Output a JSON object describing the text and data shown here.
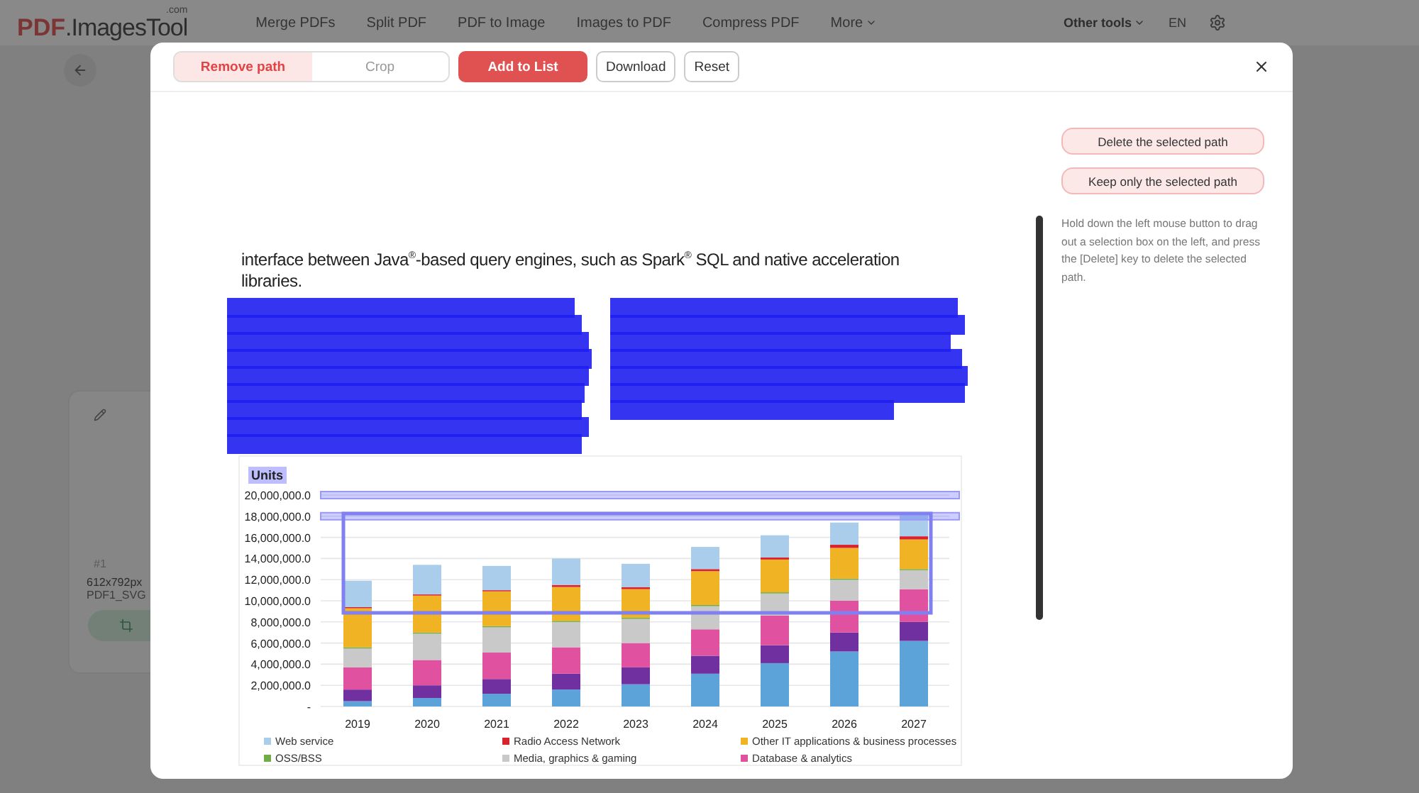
{
  "header": {
    "logo": {
      "brand": "PDF",
      "name": ".ImagesTool",
      "suffix": ".com"
    },
    "nav": [
      "Merge PDFs",
      "Split PDF",
      "PDF to Image",
      "Images to PDF",
      "Compress PDF"
    ],
    "more": "More",
    "other_tools": "Other tools",
    "language": "EN"
  },
  "file_card": {
    "index": "#1",
    "dimensions": "612x792px",
    "filename": "PDF1_SVG"
  },
  "dialog": {
    "modes": [
      {
        "label": "Remove path",
        "selected": true
      },
      {
        "label": "Crop",
        "selected": false
      }
    ],
    "buttons": [
      {
        "label": "Add to List",
        "kind": "primary"
      },
      {
        "label": "Download",
        "kind": "outline"
      },
      {
        "label": "Reset",
        "kind": "outline"
      }
    ],
    "document": {
      "paragraph": "interface between Java$^{®}$-based query engines, such as Spark$^{®}$ SQL and native acceleration libraries.",
      "chart": {
        "units": "Units",
        "chart_data": {
          "type": "bar",
          "stacked": true,
          "orientation": "vertical",
          "grid": true,
          "categories": [
            "2019",
            "2020",
            "2021",
            "2022",
            "2023",
            "2024",
            "2025",
            "2026",
            "2027"
          ],
          "ylim": [
            0,
            20000000
          ],
          "yticks": [
            {
              "value": 0,
              "label": "-"
            },
            {
              "value": 2000000,
              "label": "2,000,000.0"
            },
            {
              "value": 4000000,
              "label": "4,000,000.0"
            },
            {
              "value": 6000000,
              "label": "6,000,000.0"
            },
            {
              "value": 8000000,
              "label": "8,000,000.0"
            },
            {
              "value": 10000000,
              "label": "10,000,000.0"
            },
            {
              "value": 12000000,
              "label": "12,000,000.0"
            },
            {
              "value": 14000000,
              "label": "14,000,000.0"
            },
            {
              "value": 16000000,
              "label": "16,000,000.0"
            },
            {
              "value": 18000000,
              "label": "18,000,000.0"
            },
            {
              "value": 20000000,
              "label": "20,000,000.0"
            }
          ],
          "series": [
            {
              "color": "#5ba3d9",
              "values": [
                500000,
                800000,
                1200000,
                1600000,
                2100000,
                3100000,
                4100000,
                5200000,
                6200000
              ]
            },
            {
              "color": "#7030a0",
              "values": [
                1100000,
                1200000,
                1400000,
                1500000,
                1600000,
                1700000,
                1700000,
                1800000,
                1800000
              ]
            },
            {
              "name": "Database & analytics",
              "color": "#e052a0",
              "values": [
                2100000,
                2400000,
                2500000,
                2500000,
                2300000,
                2500000,
                2800000,
                3000000,
                3100000
              ]
            },
            {
              "name": "Media, graphics & gaming",
              "color": "#c9c9c9",
              "values": [
                1800000,
                2500000,
                2400000,
                2400000,
                2300000,
                2200000,
                2100000,
                2000000,
                1800000
              ]
            },
            {
              "name": "OSS/BSS",
              "color": "#70ad47",
              "values": [
                100000,
                100000,
                100000,
                100000,
                100000,
                100000,
                100000,
                100000,
                100000
              ]
            },
            {
              "name": "Other IT applications & business processes",
              "color": "#f0b323",
              "values": [
                3700000,
                3500000,
                3300000,
                3200000,
                2700000,
                3200000,
                3100000,
                2900000,
                2800000
              ]
            },
            {
              "name": "Radio Access Network",
              "color": "#d9232d",
              "values": [
                100000,
                100000,
                100000,
                200000,
                200000,
                200000,
                200000,
                300000,
                300000
              ]
            },
            {
              "name": "Web service",
              "color": "#a9cdea",
              "values": [
                2500000,
                2800000,
                2300000,
                2500000,
                2200000,
                2100000,
                2100000,
                2100000,
                2000000
              ]
            }
          ]
        }
      }
    },
    "actions": [
      "Delete the selected path",
      "Keep only the selected path"
    ],
    "hint": "Hold down the left mouse button to drag out a selection box on the left, and press the [Delete] key to delete the selected path."
  }
}
